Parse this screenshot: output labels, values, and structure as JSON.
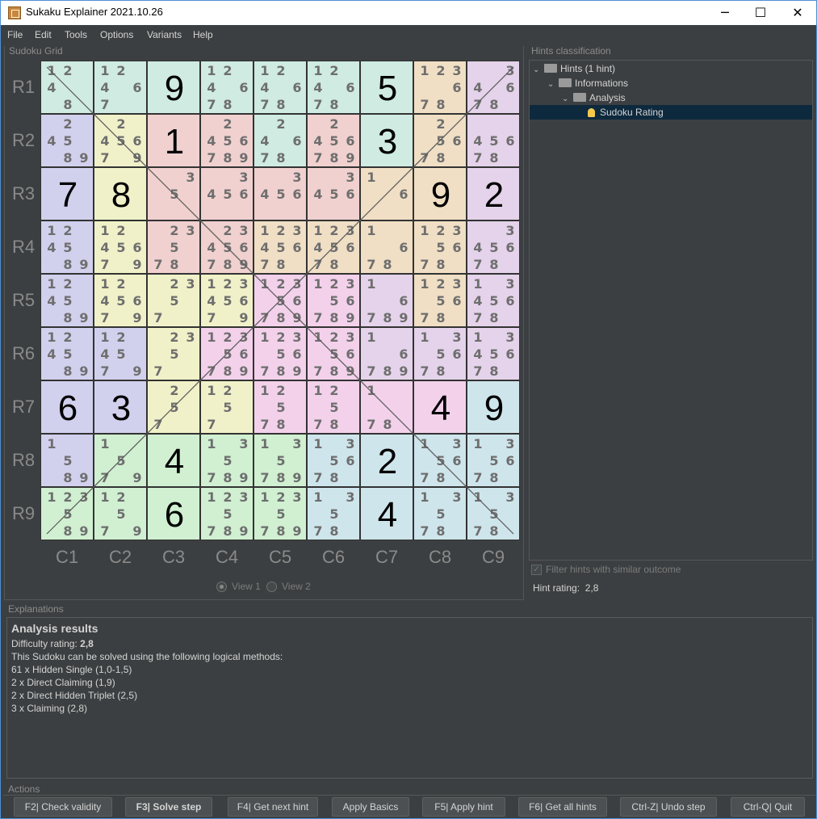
{
  "window": {
    "title": "Sukaku Explainer 2021.10.26",
    "minimize": "─",
    "maximize": "☐",
    "close": "✕"
  },
  "menu": [
    "File",
    "Edit",
    "Tools",
    "Options",
    "Variants",
    "Help"
  ],
  "grid_panel": {
    "label": "Sudoku Grid",
    "view1": "View 1",
    "view2": "View 2",
    "selected_view": "View 1"
  },
  "row_labels": [
    "R1",
    "R2",
    "R3",
    "R4",
    "R5",
    "R6",
    "R7",
    "R8",
    "R9"
  ],
  "col_labels": [
    "C1",
    "C2",
    "C3",
    "C4",
    "C5",
    "C6",
    "C7",
    "C8",
    "C9"
  ],
  "colors": {
    "b": "#d1d0ed",
    "y": "#f0f1c8",
    "r": "#f0d1cf",
    "g": "#d0f0d1",
    "t": "#cfebe2",
    "o": "#f0dfc5",
    "p": "#f3d1eb",
    "l": "#dbd8e6",
    "c": "#cfe5ec",
    "m": "#e4d3ea",
    "s": "#e8d2d8"
  },
  "grid": [
    [
      "g:12 4 8:t",
      "g:12 4 6 7:t",
      "v:9:t",
      "g:12 4 6 78:t",
      "g:12 4 6 78:t",
      "g:12 4 6 78:t",
      "v:5:t",
      "g:123 6 78:o",
      "g:3 4 6 78:m"
    ],
    [
      "g:2 45 89:b",
      "g:2 456 7 9:y",
      "v:1:r",
      "g:2 456 789:r",
      "g:2 4 6 78:t",
      "g:2 456 789:r",
      "v:3:t",
      "g:2 56 78:o",
      "g:456 78:m"
    ],
    [
      "v:7:b",
      "v:8:y",
      "g:3 5:r",
      "g:3 456:r",
      "g:3 456:r",
      "g:3 456:r",
      "g:1 6:o",
      "v:9:o",
      "v:2:m"
    ],
    [
      "g:12 45 89:b",
      "g:12 456 7 9:y",
      "g:23 5 78:r",
      "g:23 456 789:r",
      "g:123 456 78:o",
      "g:123 456 78:o",
      "g:1 6 78:o",
      "g:123 56 78:o",
      "g:3 456 78:m"
    ],
    [
      "g:12 45 89:b",
      "g:12 456 7 9:y",
      "g:23 5 7:y",
      "g:123 456 7 9:y",
      "g:123 56 789:p",
      "g:123 56 789:p",
      "g:1 6 789:m",
      "g:123 56 78:o",
      "g:1 3 456 78:m"
    ],
    [
      "g:12 45 89:b",
      "g:12 45 9 7:b",
      "g:23 5 7:y",
      "g:123 56 789:p",
      "g:123 56 789:p",
      "g:123 56 789:p",
      "g:1 6 789:m",
      "g:1 3 56 78:m",
      "g:1 3 456 78:m"
    ],
    [
      "v:6:b",
      "v:3:b",
      "g:2 5 7:y",
      "g:12 5 7:y",
      "g:12 5 78:p",
      "g:12 5 78:p",
      "g:1 78:p",
      "v:4:p",
      "v:9:c"
    ],
    [
      "g:1 5 89:b",
      "g:1 5 7 9:g",
      "v:4:g",
      "g:1 3 5 789:g",
      "g:1 3 5 789:g",
      "g:1 3 56 78:c",
      "v:2:c",
      "g:1 3 56 78:c",
      "g:1 3 56 78:c"
    ],
    [
      "g:123 5 89:g",
      "g:12 5 7 9:g",
      "v:6:g",
      "g:123 5 789:g",
      "g:123 5 789:g",
      "g:1 3 5 78:c",
      "v:4:c",
      "g:1 3 5 78:c",
      "g:1 3 5 78:c"
    ]
  ],
  "hints": {
    "label": "Hints classification",
    "tree": [
      {
        "label": "Hints (1 hint)",
        "level": 0,
        "type": "folder"
      },
      {
        "label": "Informations",
        "level": 1,
        "type": "folder"
      },
      {
        "label": "Analysis",
        "level": 2,
        "type": "folder"
      },
      {
        "label": "Sudoku Rating",
        "level": 3,
        "type": "hint",
        "selected": true
      }
    ],
    "filter_label": "Filter hints with similar outcome",
    "filter_checked": true,
    "rating_label": "Hint rating:",
    "rating_value": "2,8"
  },
  "explanations": {
    "label": "Explanations",
    "title": "Analysis results",
    "difficulty_label": "Difficulty rating:",
    "difficulty_value": "2,8",
    "lines": [
      "This Sudoku can be solved using the following logical methods:",
      "61 x Hidden Single (1,0-1,5)",
      "2 x Direct Claiming (1,9)",
      "2 x Direct Hidden Triplet (2,5)",
      "3 x Claiming (2,8)"
    ]
  },
  "actions": {
    "label": "Actions",
    "buttons": [
      "F2| Check validity",
      "F3| Solve step",
      "F4| Get next hint",
      "Apply Basics",
      "F5| Apply hint",
      "F6| Get all hints",
      "Ctrl-Z| Undo step",
      "Ctrl-Q| Quit"
    ]
  }
}
